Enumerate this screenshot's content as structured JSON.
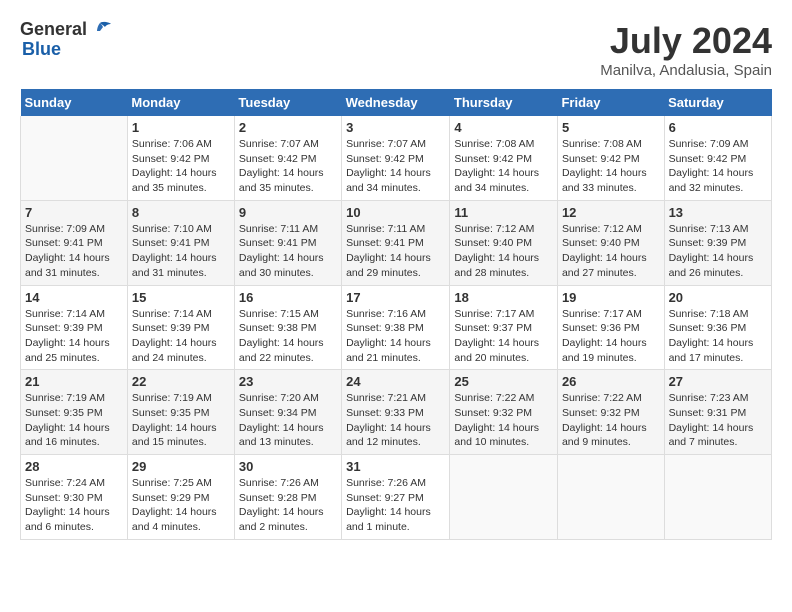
{
  "header": {
    "logo_general": "General",
    "logo_blue": "Blue",
    "month_year": "July 2024",
    "location": "Manilva, Andalusia, Spain"
  },
  "calendar": {
    "days_of_week": [
      "Sunday",
      "Monday",
      "Tuesday",
      "Wednesday",
      "Thursday",
      "Friday",
      "Saturday"
    ],
    "weeks": [
      [
        {
          "day": "",
          "empty": true
        },
        {
          "day": "1",
          "sunrise": "7:06 AM",
          "sunset": "9:42 PM",
          "daylight": "14 hours and 35 minutes."
        },
        {
          "day": "2",
          "sunrise": "7:07 AM",
          "sunset": "9:42 PM",
          "daylight": "14 hours and 35 minutes."
        },
        {
          "day": "3",
          "sunrise": "7:07 AM",
          "sunset": "9:42 PM",
          "daylight": "14 hours and 34 minutes."
        },
        {
          "day": "4",
          "sunrise": "7:08 AM",
          "sunset": "9:42 PM",
          "daylight": "14 hours and 34 minutes."
        },
        {
          "day": "5",
          "sunrise": "7:08 AM",
          "sunset": "9:42 PM",
          "daylight": "14 hours and 33 minutes."
        },
        {
          "day": "6",
          "sunrise": "7:09 AM",
          "sunset": "9:42 PM",
          "daylight": "14 hours and 32 minutes."
        }
      ],
      [
        {
          "day": "7",
          "sunrise": "7:09 AM",
          "sunset": "9:41 PM",
          "daylight": "14 hours and 31 minutes."
        },
        {
          "day": "8",
          "sunrise": "7:10 AM",
          "sunset": "9:41 PM",
          "daylight": "14 hours and 31 minutes."
        },
        {
          "day": "9",
          "sunrise": "7:11 AM",
          "sunset": "9:41 PM",
          "daylight": "14 hours and 30 minutes."
        },
        {
          "day": "10",
          "sunrise": "7:11 AM",
          "sunset": "9:41 PM",
          "daylight": "14 hours and 29 minutes."
        },
        {
          "day": "11",
          "sunrise": "7:12 AM",
          "sunset": "9:40 PM",
          "daylight": "14 hours and 28 minutes."
        },
        {
          "day": "12",
          "sunrise": "7:12 AM",
          "sunset": "9:40 PM",
          "daylight": "14 hours and 27 minutes."
        },
        {
          "day": "13",
          "sunrise": "7:13 AM",
          "sunset": "9:39 PM",
          "daylight": "14 hours and 26 minutes."
        }
      ],
      [
        {
          "day": "14",
          "sunrise": "7:14 AM",
          "sunset": "9:39 PM",
          "daylight": "14 hours and 25 minutes."
        },
        {
          "day": "15",
          "sunrise": "7:14 AM",
          "sunset": "9:39 PM",
          "daylight": "14 hours and 24 minutes."
        },
        {
          "day": "16",
          "sunrise": "7:15 AM",
          "sunset": "9:38 PM",
          "daylight": "14 hours and 22 minutes."
        },
        {
          "day": "17",
          "sunrise": "7:16 AM",
          "sunset": "9:38 PM",
          "daylight": "14 hours and 21 minutes."
        },
        {
          "day": "18",
          "sunrise": "7:17 AM",
          "sunset": "9:37 PM",
          "daylight": "14 hours and 20 minutes."
        },
        {
          "day": "19",
          "sunrise": "7:17 AM",
          "sunset": "9:36 PM",
          "daylight": "14 hours and 19 minutes."
        },
        {
          "day": "20",
          "sunrise": "7:18 AM",
          "sunset": "9:36 PM",
          "daylight": "14 hours and 17 minutes."
        }
      ],
      [
        {
          "day": "21",
          "sunrise": "7:19 AM",
          "sunset": "9:35 PM",
          "daylight": "14 hours and 16 minutes."
        },
        {
          "day": "22",
          "sunrise": "7:19 AM",
          "sunset": "9:35 PM",
          "daylight": "14 hours and 15 minutes."
        },
        {
          "day": "23",
          "sunrise": "7:20 AM",
          "sunset": "9:34 PM",
          "daylight": "14 hours and 13 minutes."
        },
        {
          "day": "24",
          "sunrise": "7:21 AM",
          "sunset": "9:33 PM",
          "daylight": "14 hours and 12 minutes."
        },
        {
          "day": "25",
          "sunrise": "7:22 AM",
          "sunset": "9:32 PM",
          "daylight": "14 hours and 10 minutes."
        },
        {
          "day": "26",
          "sunrise": "7:22 AM",
          "sunset": "9:32 PM",
          "daylight": "14 hours and 9 minutes."
        },
        {
          "day": "27",
          "sunrise": "7:23 AM",
          "sunset": "9:31 PM",
          "daylight": "14 hours and 7 minutes."
        }
      ],
      [
        {
          "day": "28",
          "sunrise": "7:24 AM",
          "sunset": "9:30 PM",
          "daylight": "14 hours and 6 minutes."
        },
        {
          "day": "29",
          "sunrise": "7:25 AM",
          "sunset": "9:29 PM",
          "daylight": "14 hours and 4 minutes."
        },
        {
          "day": "30",
          "sunrise": "7:26 AM",
          "sunset": "9:28 PM",
          "daylight": "14 hours and 2 minutes."
        },
        {
          "day": "31",
          "sunrise": "7:26 AM",
          "sunset": "9:27 PM",
          "daylight": "14 hours and 1 minute."
        },
        {
          "day": "",
          "empty": true
        },
        {
          "day": "",
          "empty": true
        },
        {
          "day": "",
          "empty": true
        }
      ]
    ]
  }
}
